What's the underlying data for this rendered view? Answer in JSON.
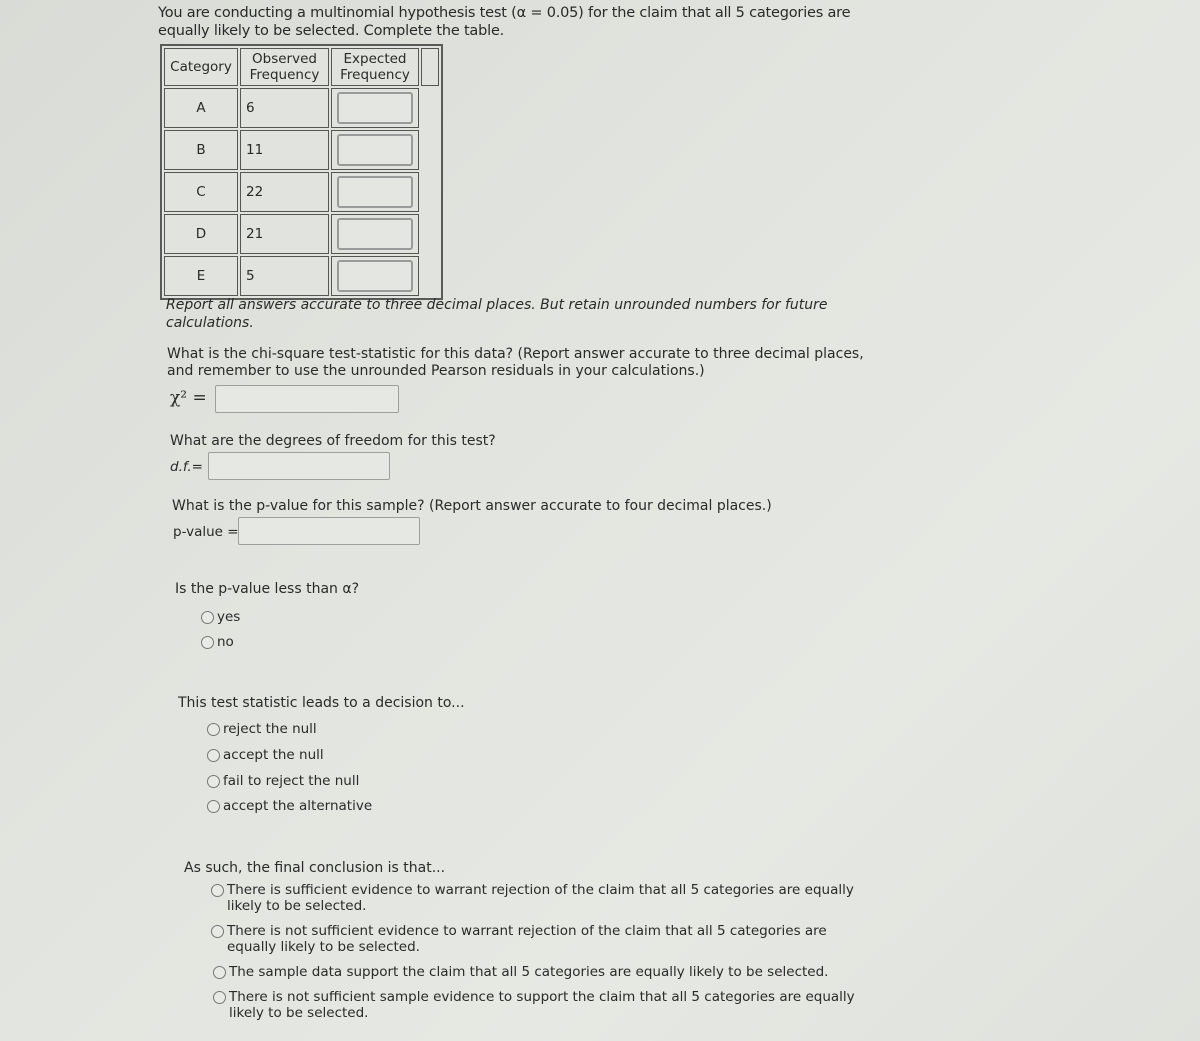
{
  "intro": "You are conducting a multinomial hypothesis test (α = 0.05) for the claim that all 5 categories are equally likely to be selected. Complete the table.",
  "table": {
    "headers": [
      "Category",
      "Observed Frequency",
      "Expected Frequency"
    ],
    "header_lines": {
      "observed": [
        "Observed",
        "Frequency"
      ],
      "expected": [
        "Expected",
        "Frequency"
      ]
    },
    "rows": [
      {
        "category": "A",
        "observed": "6",
        "expected": ""
      },
      {
        "category": "B",
        "observed": "11",
        "expected": ""
      },
      {
        "category": "C",
        "observed": "22",
        "expected": ""
      },
      {
        "category": "D",
        "observed": "21",
        "expected": ""
      },
      {
        "category": "E",
        "observed": "5",
        "expected": ""
      }
    ]
  },
  "note": "Report all answers accurate to three decimal places. But retain unrounded numbers for future calculations.",
  "chi_square": {
    "question": "What is the chi-square test-statistic for this data? (Report answer accurate to three decimal places, and remember to use the unrounded Pearson residuals in your calculations.)",
    "label": "χ² =",
    "value": ""
  },
  "df": {
    "question": "What are the degrees of freedom for this test?",
    "label": "d.f.=",
    "value": ""
  },
  "p_value": {
    "question": "What is the p-value for this sample? (Report answer accurate to four decimal places.)",
    "label": "p-value =",
    "value": ""
  },
  "compare": {
    "question": "Is the p-value less than α?",
    "options": [
      "yes",
      "no"
    ]
  },
  "decision": {
    "question": "This test statistic leads to a decision to...",
    "options": [
      "reject the null",
      "accept the null",
      "fail to reject the null",
      "accept the alternative"
    ]
  },
  "conclusion": {
    "question": "As such, the final conclusion is that...",
    "options": [
      "There is sufficient evidence to warrant rejection of the claim that all 5 categories are equally likely to be selected.",
      "There is not sufficient evidence to warrant rejection of the claim that all 5 categories are equally likely to be selected.",
      "The sample data support the claim that all 5 categories are equally likely to be selected.",
      "There is not sufficient sample evidence to support the claim that all 5 categories are equally likely to be selected."
    ]
  }
}
